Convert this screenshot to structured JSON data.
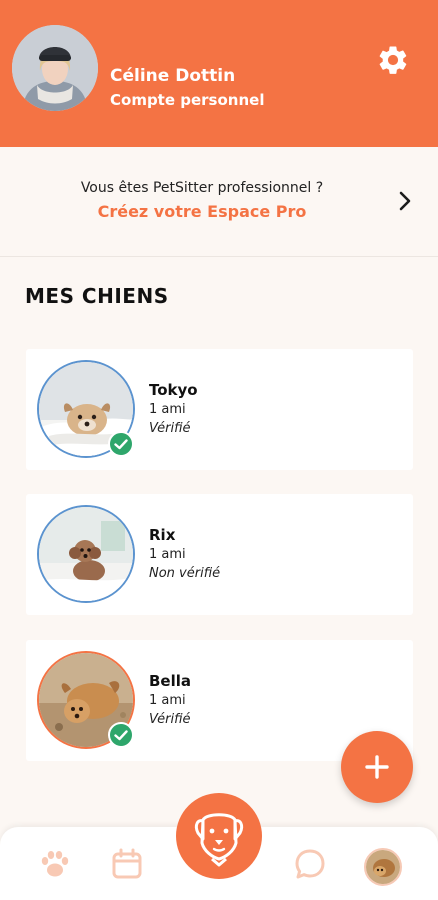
{
  "header": {
    "user_name": "Céline Dottin",
    "account_type": "Compte personnel",
    "accent_color": "#f47344"
  },
  "promo": {
    "question": "Vous êtes PetSitter professionnel ?",
    "link": "Créez votre Espace Pro"
  },
  "section_title": "MES CHIENS",
  "dogs": [
    {
      "name": "Tokyo",
      "friends": "1 ami",
      "status": "Vérifié"
    },
    {
      "name": "Rix",
      "friends": "1 ami",
      "status": "Non vérifié"
    },
    {
      "name": "Bella",
      "friends": "1 ami",
      "status": "Vérifié"
    }
  ],
  "icons": {
    "settings": "gear-icon",
    "chevron": "chevron-right-icon",
    "add": "plus-icon",
    "verified": "check-circle-icon",
    "nav": [
      "paw-icon",
      "calendar-icon",
      "dog-face-icon",
      "chat-bubble-icon",
      "dog-avatar-icon"
    ]
  }
}
